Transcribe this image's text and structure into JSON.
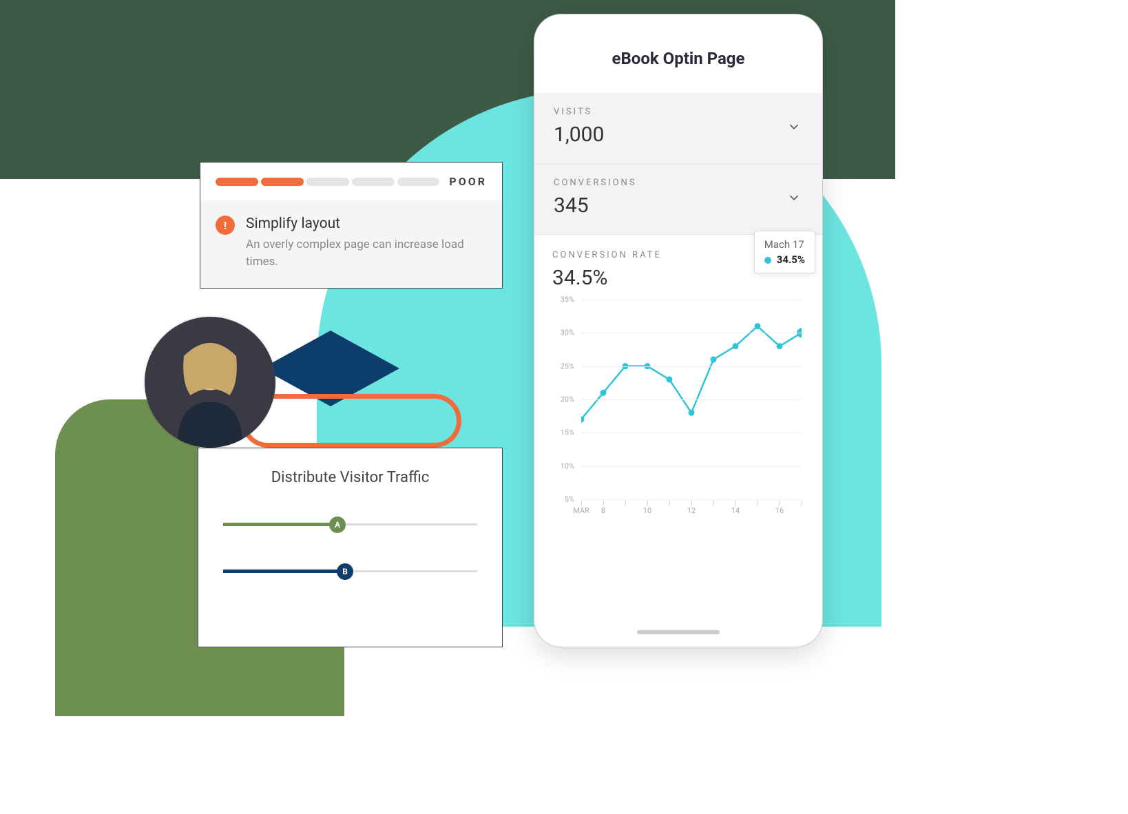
{
  "recommendation": {
    "score_label": "POOR",
    "segments_filled": 2,
    "segments_total": 5,
    "title": "Simplify layout",
    "description": "An overly complex page can increase load times."
  },
  "traffic": {
    "title": "Distribute Visitor Traffic",
    "slider_a_label": "A",
    "slider_b_label": "B"
  },
  "phone": {
    "title": "eBook Optin Page",
    "visits_label": "VISITS",
    "visits_value": "1,000",
    "conversions_label": "CONVERSIONS",
    "conversions_value": "345",
    "rate_label": "CONVERSION RATE",
    "rate_value": "34.5%",
    "tooltip_date": "Mach 17",
    "tooltip_value": "34.5%",
    "x_start_label": "MAR"
  },
  "chart_data": {
    "type": "line",
    "title": "Conversion Rate",
    "ylabel": "",
    "xlabel": "",
    "ylim": [
      5,
      35
    ],
    "y_ticks": [
      5,
      10,
      15,
      20,
      25,
      30,
      35
    ],
    "x_ticks": [
      "MAR",
      8,
      10,
      12,
      14,
      16
    ],
    "x": [
      7,
      8,
      9,
      10,
      11,
      12,
      13,
      14,
      15,
      16,
      17
    ],
    "values": [
      17,
      21,
      25,
      25,
      23,
      18,
      26,
      28,
      31,
      28,
      30
    ]
  }
}
